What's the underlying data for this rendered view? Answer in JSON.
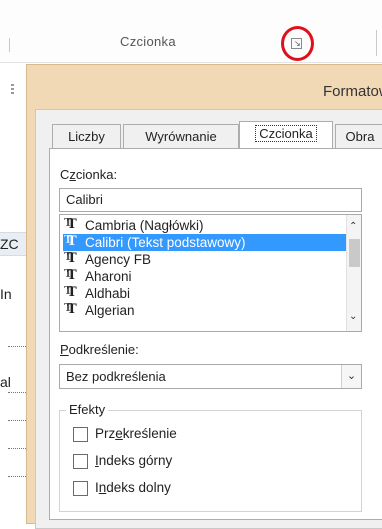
{
  "ribbon": {
    "group_label": "Czcionka",
    "launcher_icon": "dialog-launcher-icon",
    "highlight_color": "#e0101a"
  },
  "background": {
    "text_zc": "ZC",
    "text_in": "In",
    "text_al": "al"
  },
  "dialog": {
    "title": "Formatow",
    "tabs": [
      {
        "label": "Liczby"
      },
      {
        "label": "Wyrównanie"
      },
      {
        "label": "Czcionka"
      },
      {
        "label": "Obra"
      }
    ],
    "active_tab": "Czcionka",
    "font": {
      "label_prefix": "C",
      "label_underlined": "z",
      "label_suffix": "cionka:",
      "value": "Calibri",
      "list": [
        {
          "name": "Cambria (Nagłówki)"
        },
        {
          "name": "Calibri (Tekst podstawowy)"
        },
        {
          "name": "Agency FB"
        },
        {
          "name": "Aharoni"
        },
        {
          "name": "Aldhabi"
        },
        {
          "name": "Algerian"
        }
      ],
      "selected_index": 1
    },
    "underline": {
      "label_underlined": "P",
      "label_suffix": "odkreślenie:",
      "value": "Bez podkreślenia"
    },
    "effects": {
      "legend": "Efekty",
      "strikethrough": {
        "pre": "Prz",
        "u": "e",
        "post": "kreślenie"
      },
      "superscript": {
        "pre": "",
        "u": "I",
        "post": "ndeks górny"
      },
      "subscript": {
        "pre": "I",
        "u": "n",
        "post": "deks dolny"
      }
    },
    "accent_color": "#f2d9b5",
    "selection_color": "#3399ff"
  }
}
